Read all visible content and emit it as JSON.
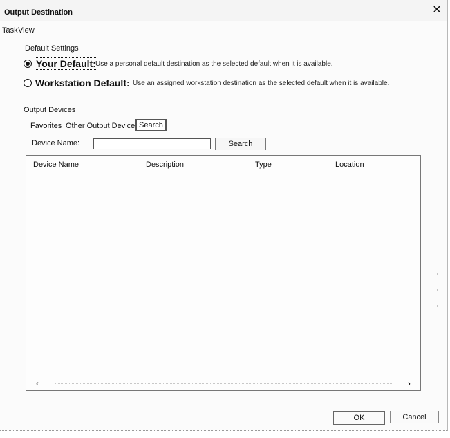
{
  "window": {
    "title": "Output Destination",
    "close_glyph": "✕"
  },
  "menu": [
    "Task",
    "View"
  ],
  "default_settings": {
    "label": "Default Settings",
    "options": [
      {
        "label": "Your Default:",
        "description": "Use a personal default destination as the selected default when it is available.",
        "selected": true
      },
      {
        "label": "Workstation Default:",
        "description": "Use an assigned workstation destination as the selected default when it is available.",
        "selected": false
      }
    ]
  },
  "output_devices": {
    "label": "Output Devices",
    "tabs": [
      "Favorites",
      "Other Output Devices",
      "Search"
    ],
    "active_tab": "Search",
    "device_name_label": "Device Name:",
    "device_name_value": "",
    "search_button": "Search",
    "columns": [
      "Device Name",
      "Description",
      "Type",
      "Location"
    ],
    "rows": [],
    "scroll_left_icon": "‹",
    "scroll_right_icon": "›"
  },
  "footer": {
    "ok": "OK",
    "cancel": "Cancel"
  },
  "icons": {
    "close": "close-icon",
    "radio_selected": "radio-selected-icon",
    "radio_unselected": "radio-unselected-icon"
  }
}
